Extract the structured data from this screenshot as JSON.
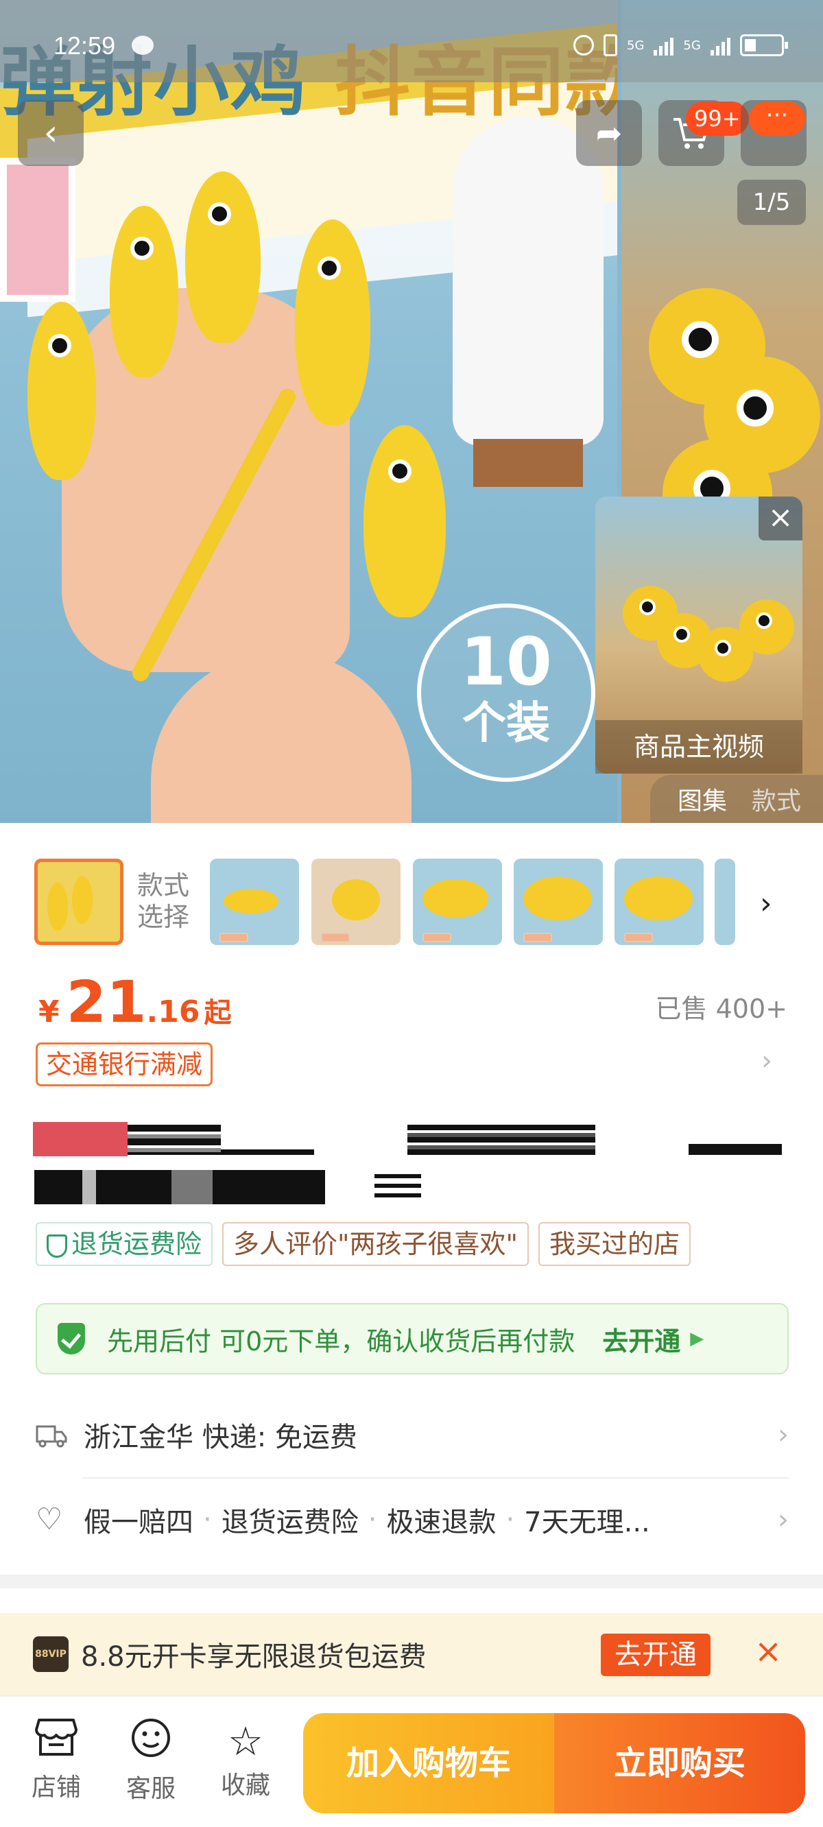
{
  "status_bar": {
    "time": "12:59",
    "network_1": "5G",
    "network_2": "5G"
  },
  "hero": {
    "title_part1": "弹射小鸡",
    "title_part2": "抖音同款",
    "badge_number": "10",
    "badge_unit": "个装",
    "cart_count": "99+",
    "more_label": "···",
    "counter": "1/5",
    "mini_video_label": "商品主视频",
    "media_tabs": [
      "图集",
      "款式"
    ]
  },
  "variants": {
    "label_line1": "款式",
    "label_line2": "选择",
    "count": 6
  },
  "price": {
    "currency": "¥",
    "integer": "21",
    "decimal": ".16",
    "suffix": "起",
    "sold": "已售 400+"
  },
  "promo": {
    "label": "交通银行满减"
  },
  "tags": [
    {
      "label": "退货运费险",
      "style": "green"
    },
    {
      "label": "多人评价\"两孩子很喜欢\"",
      "style": "normal"
    },
    {
      "label": "我买过的店",
      "style": "normal"
    }
  ],
  "paylater": {
    "text": "先用后付  可0元下单，确认收货后再付款",
    "cta": "去开通"
  },
  "shipping": {
    "text": "浙江金华  快递:  免运费"
  },
  "guarantees": [
    "假一赔四",
    "退货运费险",
    "极速退款",
    "7天无理..."
  ],
  "vip": {
    "logo": "88VIP",
    "text": "8.8元开卡享无限退货包运费",
    "cta": "去开通"
  },
  "bottom_bar": {
    "store": "店铺",
    "service": "客服",
    "favorite": "收藏",
    "add_to_cart": "加入购物车",
    "buy_now": "立即购买"
  },
  "colors": {
    "accent": "#f0531b",
    "green": "#2f8f3a",
    "cart_yellow": "#fbc12b"
  }
}
